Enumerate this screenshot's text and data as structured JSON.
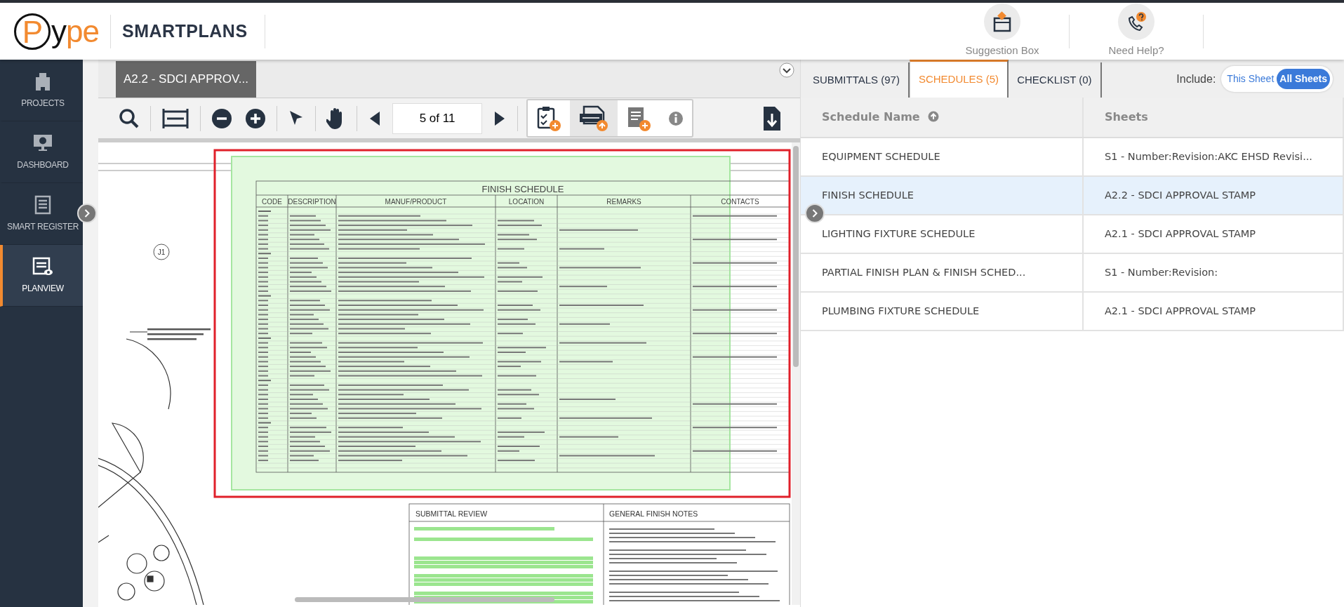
{
  "header": {
    "logo": "Pype",
    "brand": "SMARTPLANS",
    "actions": [
      {
        "kind": "suggestion",
        "label": "Suggestion Box"
      },
      {
        "kind": "help",
        "label": "Need Help?"
      }
    ]
  },
  "sidebar": {
    "items": [
      {
        "kind": "projects",
        "label": "PROJECTS",
        "selected": false
      },
      {
        "kind": "dashboard",
        "label": "DASHBOARD",
        "selected": false
      },
      {
        "kind": "register",
        "label": "SMART REGISTER",
        "selected": false
      },
      {
        "kind": "planview",
        "label": "PLANVIEW",
        "selected": true
      }
    ]
  },
  "viewer": {
    "sheet_tab": "A2.2 - SDCI APPROV...",
    "page": "5 of 11",
    "drawing": {
      "schedule_title": "FINISH SCHEDULE",
      "columns": [
        "CODE",
        "DESCRIPTION",
        "MANUF/PRODUCT",
        "LOCATION",
        "REMARKS",
        "CONTACTS"
      ],
      "marker": "J1",
      "notes": [
        "SUBMITTAL REVIEW",
        "GENERAL FINISH NOTES"
      ]
    }
  },
  "panel": {
    "tabs": [
      {
        "label": "SUBMITTALS (97)",
        "selected": false
      },
      {
        "label": "SCHEDULES (5)",
        "selected": true
      },
      {
        "label": "CHECKLIST (0)",
        "selected": false
      }
    ],
    "include": {
      "label": "Include:",
      "options": [
        {
          "label": "This Sheet",
          "selected": false
        },
        {
          "label": "All Sheets",
          "selected": true
        }
      ]
    },
    "table": {
      "columns": [
        "Schedule Name",
        "Sheets"
      ],
      "rows": [
        {
          "name": "EQUIPMENT SCHEDULE",
          "sheets": "S1 - Number:Revision:AKC EHSD Revisi...",
          "selected": false
        },
        {
          "name": "FINISH SCHEDULE",
          "sheets": "A2.2 - SDCI APPROVAL STAMP",
          "selected": true
        },
        {
          "name": "LIGHTING FIXTURE SCHEDULE",
          "sheets": "A2.1 - SDCI APPROVAL STAMP",
          "selected": false
        },
        {
          "name": "PARTIAL FINISH PLAN & FINISH SCHED...",
          "sheets": "S1 - Number:Revision:",
          "selected": false
        },
        {
          "name": "PLUMBING FIXTURE SCHEDULE",
          "sheets": "A2.1 - SDCI APPROVAL STAMP",
          "selected": false
        }
      ]
    }
  }
}
